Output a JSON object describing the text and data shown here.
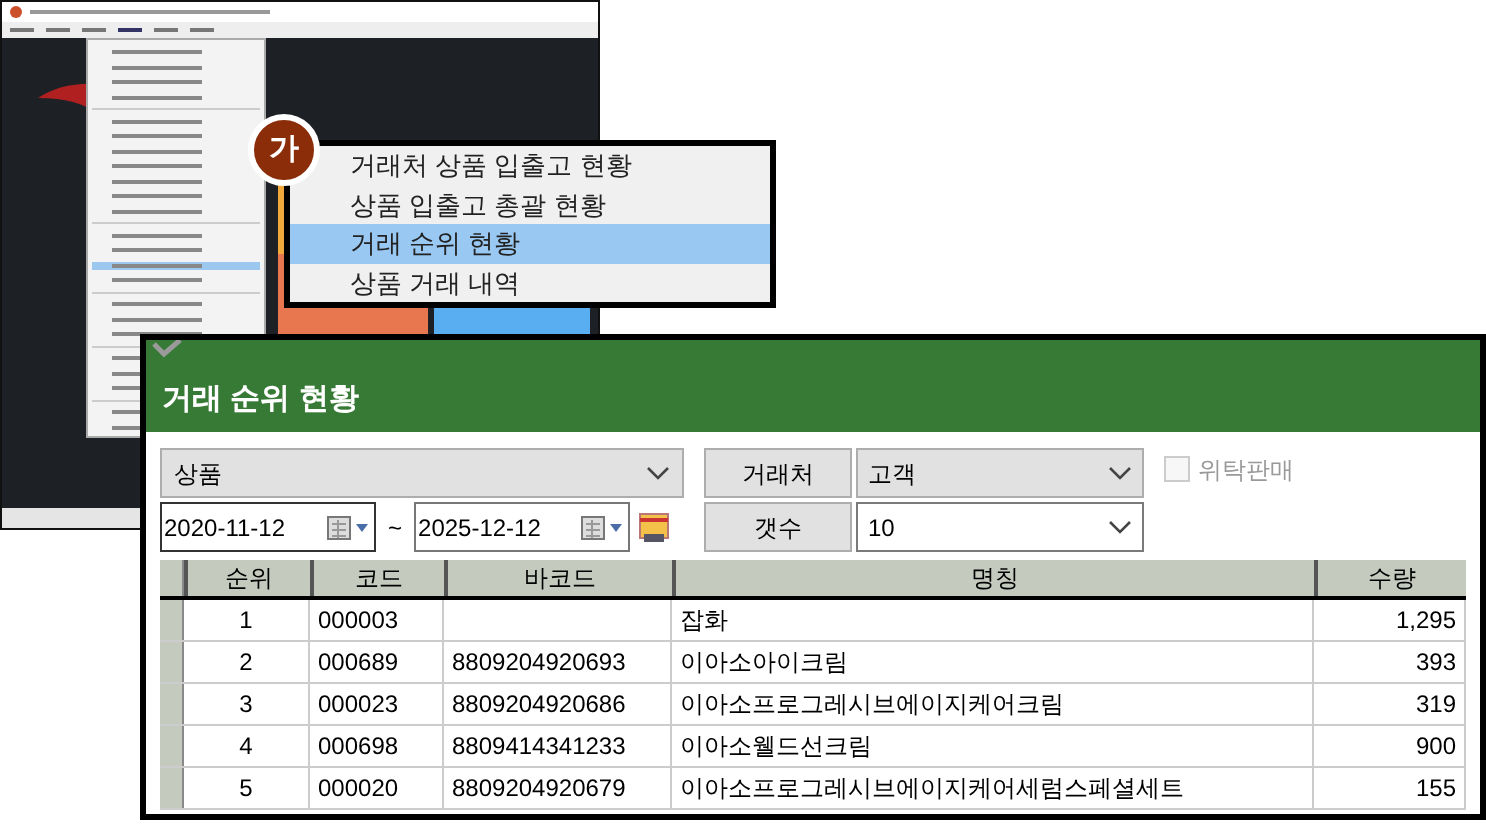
{
  "callout": {
    "badge": "가",
    "items": [
      {
        "label": "거래처 상품 입출고 현황",
        "selected": false
      },
      {
        "label": "상품 입출고 총괄 현황",
        "selected": false
      },
      {
        "label": "거래 순위 현황",
        "selected": true
      },
      {
        "label": "상품 거래 내역",
        "selected": false
      }
    ]
  },
  "panel": {
    "title": "거래 순위 현황",
    "type_select": {
      "value": "상품"
    },
    "date_from": {
      "value": "2020-11-12"
    },
    "range_sep": "~",
    "date_to": {
      "value": "2025-12-12"
    },
    "partner_button": "거래처",
    "partner_select": {
      "value": "고객"
    },
    "count_button": "갯수",
    "count_select": {
      "value": "10"
    },
    "consignment": {
      "label": "위탁판매",
      "checked": false,
      "disabled": true
    },
    "table": {
      "columns": [
        "순위",
        "코드",
        "바코드",
        "명칭",
        "수량"
      ],
      "rows": [
        [
          "1",
          "000003",
          "",
          "잡화",
          "1,295"
        ],
        [
          "2",
          "000689",
          "8809204920693",
          "이아소아이크림",
          "393"
        ],
        [
          "3",
          "000023",
          "8809204920686",
          "이아소프로그레시브에이지케어크림",
          "319"
        ],
        [
          "4",
          "000698",
          "8809414341233",
          "이아소웰드선크림",
          "900"
        ],
        [
          "5",
          "000020",
          "8809204920679",
          "이아소프로그레시브에이지케어세럼스페셜세트",
          "155"
        ]
      ]
    }
  }
}
